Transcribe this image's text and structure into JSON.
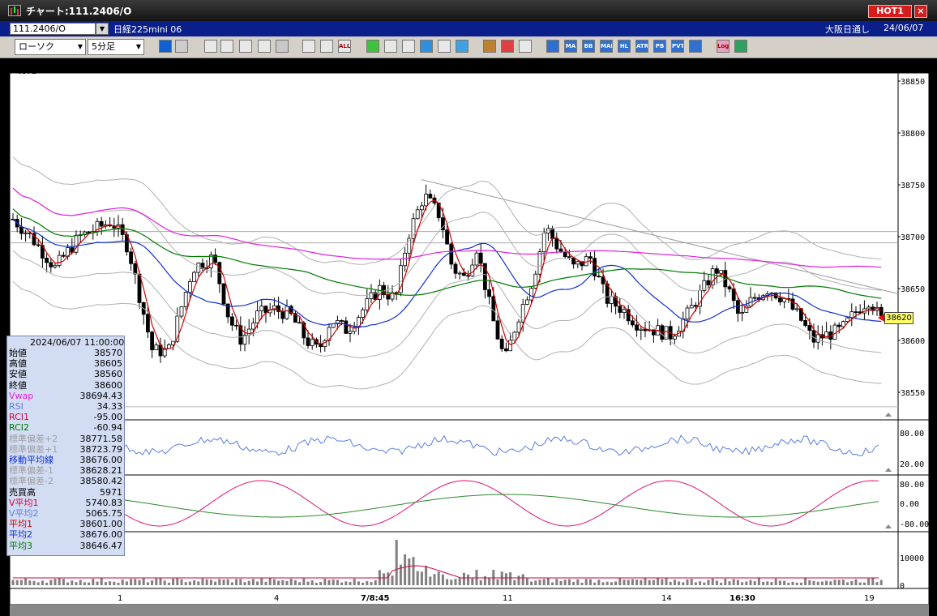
{
  "window": {
    "title": "チャート:111.2406/O",
    "hot_badge": "HOT1",
    "close_label": "×"
  },
  "infobar": {
    "symbol": "111.2406/O",
    "instrument": "日経225mini 06",
    "exchange": "大阪日通し",
    "date": "24/06/07"
  },
  "toolbar": {
    "chart_type": "ローソク",
    "period": "5分足"
  },
  "chart": {
    "period_label": "5分足",
    "price_axis": [
      "38850",
      "38800",
      "38750",
      "38700",
      "38650",
      "38600",
      "38550"
    ],
    "rsi_axis": [
      "80.00",
      "20.00"
    ],
    "rci_axis": [
      "80.00",
      "0.00",
      "-80.00"
    ],
    "volume_axis": [
      "10000",
      "0"
    ],
    "time_labels": [
      "1",
      "4",
      "7/8:45",
      "11",
      "14",
      "16:30",
      "19"
    ],
    "current_price": "38620"
  },
  "info_panel": {
    "timestamp": "2024/06/07 11:00:00",
    "rows": [
      {
        "label": "始値",
        "value": "38570",
        "color": "#000000"
      },
      {
        "label": "高値",
        "value": "38605",
        "color": "#000000"
      },
      {
        "label": "安値",
        "value": "38560",
        "color": "#000000"
      },
      {
        "label": "終値",
        "value": "38600",
        "color": "#000000"
      },
      {
        "label": "Vwap",
        "value": "38694.43",
        "color": "#e020e0"
      },
      {
        "label": "RSI",
        "value": "34.33",
        "color": "#5a7fe0"
      },
      {
        "label": "RCI1",
        "value": "-95.00",
        "color": "#d0004a"
      },
      {
        "label": "RCI2",
        "value": "-60.94",
        "color": "#007a00"
      },
      {
        "label": "標準偏差+2",
        "value": "38771.58",
        "color": "#a0a0a0"
      },
      {
        "label": "標準偏差+1",
        "value": "38723.79",
        "color": "#a0a0a0"
      },
      {
        "label": "移動平均線",
        "value": "38676.00",
        "color": "#1030d0"
      },
      {
        "label": "標準偏差-1",
        "value": "38628.21",
        "color": "#a0a0a0"
      },
      {
        "label": "標準偏差-2",
        "value": "38580.42",
        "color": "#a0a0a0"
      },
      {
        "label": "売買高",
        "value": "5971",
        "color": "#000000"
      },
      {
        "label": "V平均1",
        "value": "5740.83",
        "color": "#d0004a"
      },
      {
        "label": "V平均2",
        "value": "5065.75",
        "color": "#5a7fe0"
      },
      {
        "label": "平均1",
        "value": "38601.00",
        "color": "#d00000"
      },
      {
        "label": "平均2",
        "value": "38676.00",
        "color": "#1030d0"
      },
      {
        "label": "平均3",
        "value": "38646.47",
        "color": "#007a00"
      }
    ]
  }
}
